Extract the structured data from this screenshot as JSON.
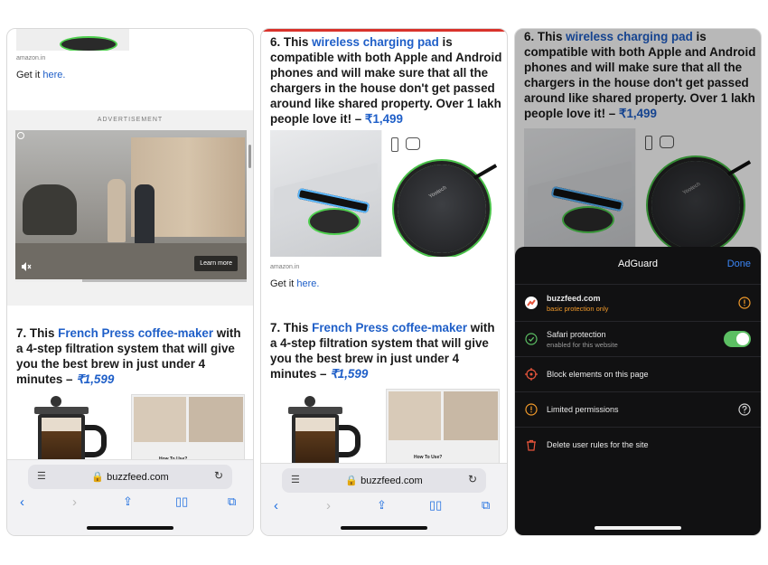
{
  "panel1": {
    "source_top": "amazon.in",
    "get_it_prefix": "Get it ",
    "get_it_link": "here.",
    "ad_label": "ADVERTISEMENT",
    "ad_button": "Learn more",
    "item7_num": "7. This ",
    "item7_link": "French Press coffee-maker",
    "item7_rest": " with a 4-step filtration system that will give you the best brew in just under 4 minutes – ",
    "item7_price": "₹1,599",
    "url": "buzzfeed.com",
    "tutorial_label": "How To Use?"
  },
  "panel2": {
    "item6_num": "6. This ",
    "item6_link": "wireless charging pad",
    "item6_rest": " is compatible with both Apple and Android phones and will make sure that all the chargers in the house don't get passed around like shared property. Over 1 lakh people love it! – ",
    "item6_price": "₹1,499",
    "source": "amazon.in",
    "get_it_prefix": "Get it ",
    "get_it_link": "here.",
    "pad_brand": "Yootech",
    "item7_num": "7. This ",
    "item7_link": "French Press coffee-maker",
    "item7_rest": " with a 4-step filtration system that will give you the best brew in just under 4 minutes – ",
    "item7_price": "₹1,599",
    "url": "buzzfeed.com",
    "tutorial_label": "How To Use?"
  },
  "panel3": {
    "item6_num": "6. This ",
    "item6_link": "wireless charging pad",
    "item6_rest": " is compatible with both Apple and Android phones and will make sure that all the chargers in the house don't get passed around like shared property. Over 1 lakh people love it! – ",
    "item6_price": "₹1,499",
    "pad_brand": "Yootech",
    "adguard": {
      "title": "AdGuard",
      "done": "Done",
      "site": "buzzfeed.com",
      "site_status": "basic protection only",
      "safari_title": "Safari protection",
      "safari_sub": "enabled for this website",
      "safari_enabled": true,
      "block_elements": "Block elements on this page",
      "limited": "Limited permissions",
      "delete_rules": "Delete user rules for the site"
    }
  },
  "colors": {
    "link_blue": "#1f5fc8",
    "toolbar_blue": "#1f6fe0",
    "toggle_green": "#5cbf63",
    "warning_orange": "#f19a2b",
    "danger_red": "#e5543b",
    "adguard_done": "#3b86f7"
  }
}
